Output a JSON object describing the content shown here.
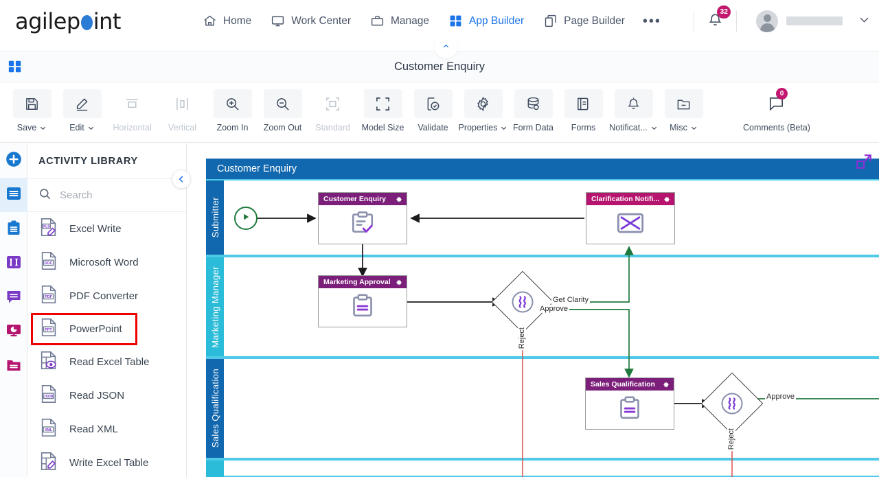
{
  "header": {
    "logo_text_a": "agilep",
    "logo_text_b": "int",
    "nav": [
      {
        "label": "Home",
        "icon": "home-icon",
        "active": false
      },
      {
        "label": "Work Center",
        "icon": "monitor-icon",
        "active": false
      },
      {
        "label": "Manage",
        "icon": "briefcase-icon",
        "active": false
      },
      {
        "label": "App Builder",
        "icon": "grid-icon",
        "active": true
      },
      {
        "label": "Page Builder",
        "icon": "copy-icon",
        "active": false
      }
    ],
    "more_label": "•••",
    "notification_count": "32",
    "username": ""
  },
  "titlebar": {
    "title": "Customer Enquiry"
  },
  "toolbar": {
    "items": [
      {
        "label": "Save",
        "icon": "save-icon",
        "caret": true,
        "disabled": false,
        "badge": ""
      },
      {
        "label": "Edit",
        "icon": "pencil-icon",
        "caret": true,
        "disabled": false,
        "badge": ""
      },
      {
        "label": "Horizontal",
        "icon": "horizontal-align-icon",
        "caret": false,
        "disabled": true,
        "badge": ""
      },
      {
        "label": "Vertical",
        "icon": "vertical-align-icon",
        "caret": false,
        "disabled": true,
        "badge": ""
      },
      {
        "label": "Zoom In",
        "icon": "zoom-in-icon",
        "caret": false,
        "disabled": false,
        "badge": ""
      },
      {
        "label": "Zoom Out",
        "icon": "zoom-out-icon",
        "caret": false,
        "disabled": false,
        "badge": ""
      },
      {
        "label": "Standard",
        "icon": "standard-size-icon",
        "caret": false,
        "disabled": true,
        "badge": ""
      },
      {
        "label": "Model Size",
        "icon": "model-size-icon",
        "caret": false,
        "disabled": false,
        "badge": ""
      },
      {
        "label": "Validate",
        "icon": "validate-icon",
        "caret": false,
        "disabled": false,
        "badge": ""
      },
      {
        "label": "Properties",
        "icon": "gear-icon",
        "caret": true,
        "disabled": false,
        "badge": ""
      },
      {
        "label": "Form Data",
        "icon": "database-icon",
        "caret": false,
        "disabled": false,
        "badge": ""
      },
      {
        "label": "Forms",
        "icon": "forms-icon",
        "caret": false,
        "disabled": false,
        "badge": ""
      },
      {
        "label": "Notificat...",
        "icon": "bell-icon",
        "caret": true,
        "disabled": false,
        "badge": ""
      },
      {
        "label": "Misc",
        "icon": "folder-icon",
        "caret": true,
        "disabled": false,
        "badge": ""
      },
      {
        "label": "Comments (Beta)",
        "icon": "comment-icon",
        "caret": false,
        "disabled": false,
        "badge": "0"
      }
    ]
  },
  "rail": {
    "items": [
      {
        "name": "add-icon",
        "color": "#1878cf",
        "shape": "circle-plus"
      },
      {
        "name": "activity-library-icon",
        "color": "#1878cf",
        "shape": "list",
        "selected": true
      },
      {
        "name": "clipboard-icon",
        "color": "#1878cf",
        "shape": "clipboard"
      },
      {
        "name": "swimlane-icon",
        "color": "#7a3ac6",
        "shape": "pillars"
      },
      {
        "name": "chat-icon",
        "color": "#7a3ac6",
        "shape": "chat"
      },
      {
        "name": "report-icon",
        "color": "#b5156e",
        "shape": "monitor-chart"
      },
      {
        "name": "folder-icon",
        "color": "#b5156e",
        "shape": "folder"
      }
    ]
  },
  "panel": {
    "header": "ACTIVITY LIBRARY",
    "search_placeholder": "Search",
    "search_value": "",
    "items": [
      {
        "label": "Excel Write",
        "icon": "xls-write-icon",
        "tag": "XLS",
        "highlighted": false
      },
      {
        "label": "Microsoft Word",
        "icon": "doc-icon",
        "tag": "DOC",
        "highlighted": false
      },
      {
        "label": "PDF Converter",
        "icon": "pdf-icon",
        "tag": "PDF",
        "highlighted": false
      },
      {
        "label": "PowerPoint",
        "icon": "ppt-icon",
        "tag": "PPT",
        "highlighted": true
      },
      {
        "label": "Read Excel Table",
        "icon": "read-excel-table-icon",
        "tag": "",
        "highlighted": false
      },
      {
        "label": "Read JSON",
        "icon": "json-icon",
        "tag": "JSON",
        "highlighted": false
      },
      {
        "label": "Read XML",
        "icon": "xml-icon",
        "tag": "XML",
        "highlighted": false
      },
      {
        "label": "Write Excel Table",
        "icon": "write-excel-table-icon",
        "tag": "",
        "highlighted": false
      }
    ],
    "highlight_color": "#ef0000"
  },
  "diagram": {
    "pool_title": "Customer Enquiry",
    "lanes": [
      {
        "label": "Submitter",
        "color": "#1268ae"
      },
      {
        "label": "Marketing Manager",
        "color": "#2bbcd9"
      },
      {
        "label": "Sales Qualification",
        "color": "#1268ae"
      },
      {
        "label": "",
        "color": "#2bbcd9"
      }
    ],
    "start_event": {
      "name": "start-event",
      "color": "#1f7a3d"
    },
    "tasks": [
      {
        "title": "Customer Enquiry",
        "icon": "clipboard-check-icon",
        "header_color": "#7b1f7a",
        "lane": "Submitter"
      },
      {
        "title": "Clarification Notifi...",
        "icon": "envelope-icon",
        "header_color": "#b5156e",
        "lane": "Submitter"
      },
      {
        "title": "Marketing Approval",
        "icon": "clipboard-lines-icon",
        "header_color": "#7b1f7a",
        "lane": "Marketing Manager"
      },
      {
        "title": "Sales Qualification",
        "icon": "clipboard-lines-icon",
        "header_color": "#7b1f7a",
        "lane": "Sales Qualification"
      }
    ],
    "gateways": [
      {
        "name": "marketing-gateway",
        "icon": "complex-gateway-icon",
        "lane": "Marketing Manager"
      },
      {
        "name": "sales-gateway",
        "icon": "complex-gateway-icon",
        "lane": "Sales Qualification"
      }
    ],
    "flow_labels": [
      {
        "text": "Get Clarity",
        "color": "#1f7a3d"
      },
      {
        "text": "Approve",
        "color": "#1f7a3d"
      },
      {
        "text": "Reject",
        "color": "#d9534f"
      },
      {
        "text": "Approve",
        "color": "#1f7a3d"
      },
      {
        "text": "Reject",
        "color": "#d9534f"
      }
    ],
    "expand_icon": "expand-canvas-icon"
  }
}
